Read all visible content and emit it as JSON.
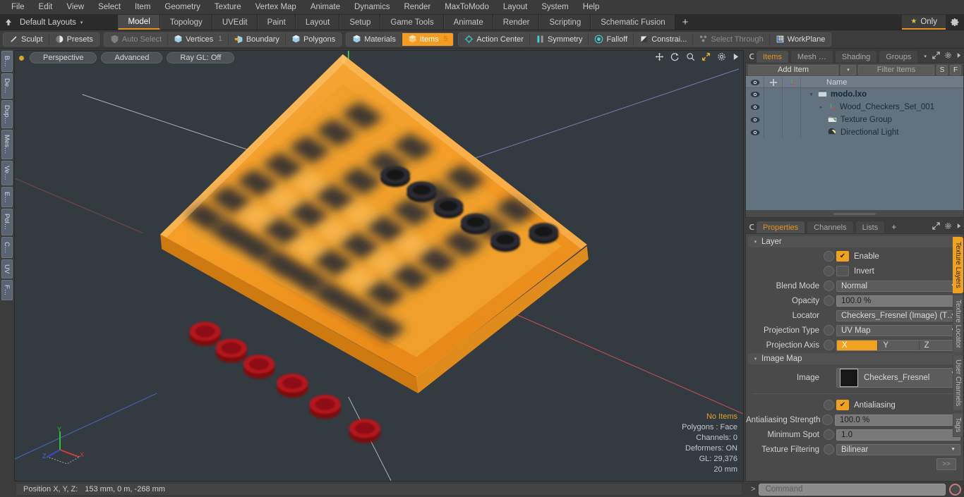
{
  "app": {
    "title": "modo",
    "accent": "#f0a11e",
    "panel_bg": "#4a4a4a",
    "viewport_bg": "#333b40"
  },
  "menubar": {
    "items": [
      {
        "label": "File"
      },
      {
        "label": "Edit"
      },
      {
        "label": "View"
      },
      {
        "label": "Select"
      },
      {
        "label": "Item"
      },
      {
        "label": "Geometry"
      },
      {
        "label": "Texture"
      },
      {
        "label": "Vertex Map"
      },
      {
        "label": "Animate"
      },
      {
        "label": "Dynamics"
      },
      {
        "label": "Render"
      },
      {
        "label": "MaxToModo"
      },
      {
        "label": "Layout"
      },
      {
        "label": "System"
      },
      {
        "label": "Help"
      }
    ]
  },
  "layoutbar": {
    "home_icon": "home-icon",
    "layout_name": "Default Layouts",
    "caret": "▾",
    "tabs": [
      {
        "label": "Model",
        "active": true
      },
      {
        "label": "Topology",
        "active": false
      },
      {
        "label": "UVEdit",
        "active": false
      },
      {
        "label": "Paint",
        "active": false
      },
      {
        "label": "Layout",
        "active": false
      },
      {
        "label": "Setup",
        "active": false
      },
      {
        "label": "Game Tools",
        "active": false
      },
      {
        "label": "Animate",
        "active": false
      },
      {
        "label": "Render",
        "active": false
      },
      {
        "label": "Scripting",
        "active": false
      },
      {
        "label": "Schematic Fusion",
        "active": false
      }
    ],
    "add_tab": "+",
    "only_label": "Only",
    "only_star": "★",
    "gear_icon": "gear-icon"
  },
  "toolbar": {
    "group_left": [
      {
        "label": "Sculpt",
        "icon": "sculpt-pen-icon",
        "state": "normal"
      },
      {
        "label": "Presets",
        "icon": "presets-sphere-icon",
        "state": "normal"
      }
    ],
    "group_select": [
      {
        "label": "Auto Select",
        "icon": "auto-select-icon",
        "state": "dim",
        "count": ""
      },
      {
        "label": "Vertices",
        "icon": "vertices-icon",
        "state": "normal",
        "count": "1"
      },
      {
        "label": "Boundary",
        "icon": "boundary-icon",
        "state": "normal",
        "count": ""
      },
      {
        "label": "Polygons",
        "icon": "polygons-icon",
        "state": "normal",
        "count": ""
      }
    ],
    "group_items": [
      {
        "label": "Materials",
        "icon": "materials-icon",
        "state": "normal",
        "count": ""
      },
      {
        "label": "Items",
        "icon": "items-icon",
        "state": "active",
        "count": "5"
      }
    ],
    "group_tools": [
      {
        "label": "Action Center",
        "icon": "action-center-icon",
        "state": "normal"
      },
      {
        "label": "Symmetry",
        "icon": "symmetry-icon",
        "state": "normal"
      },
      {
        "label": "Falloff",
        "icon": "falloff-icon",
        "state": "normal"
      },
      {
        "label": "Constrai...",
        "icon": "constraint-icon",
        "state": "normal"
      },
      {
        "label": "Select Through",
        "icon": "select-through-icon",
        "state": "dim"
      },
      {
        "label": "WorkPlane",
        "icon": "workplane-icon",
        "state": "normal"
      }
    ]
  },
  "left_tabs": [
    {
      "label": "B…"
    },
    {
      "label": "De…"
    },
    {
      "label": "Dup…"
    },
    {
      "label": "Mes…"
    },
    {
      "label": "Ve…"
    },
    {
      "label": "E…"
    },
    {
      "label": "Pol…"
    },
    {
      "label": "C…"
    },
    {
      "label": "UV"
    },
    {
      "label": "F…"
    }
  ],
  "viewport": {
    "mode": "Perspective",
    "shading": "Advanced",
    "raygl": "Ray GL: Off",
    "icons": [
      {
        "name": "move-icon",
        "glyph": "✥"
      },
      {
        "name": "rotate-icon",
        "glyph": "↻"
      },
      {
        "name": "zoom-icon",
        "glyph": "⌕"
      },
      {
        "name": "fit-icon",
        "glyph": "⤡"
      },
      {
        "name": "gear-icon",
        "glyph": "⚙"
      },
      {
        "name": "play-icon",
        "glyph": "▸"
      }
    ],
    "stats": [
      {
        "text": "No Items",
        "highlight": true
      },
      {
        "text": "Polygons : Face",
        "highlight": false
      },
      {
        "text": "Channels: 0",
        "highlight": false
      },
      {
        "text": "Deformers: ON",
        "highlight": false
      },
      {
        "text": "GL: 29,376",
        "highlight": false
      },
      {
        "text": "20 mm",
        "highlight": false
      }
    ],
    "gizmo": {
      "x": "X",
      "y": "Y",
      "z": "Z"
    },
    "scene_description": "Orange wooden checkers board with red checkers along the near-left edge and black checkers along the far-right edge"
  },
  "statusbar": {
    "position_label": "Position X, Y, Z:",
    "position_value": "153 mm, 0 m, -268 mm"
  },
  "items_panel": {
    "tabs": [
      {
        "label": "Items",
        "active": true
      },
      {
        "label": "Mesh …",
        "active": false
      },
      {
        "label": "Shading",
        "active": false
      },
      {
        "label": "Groups",
        "active": false
      }
    ],
    "tab_caret": "▾",
    "expand_icon": "expand-icon",
    "gear_icon": "gear-icon",
    "more_icon": "chevron-right-icon",
    "add_item_label": "Add Item",
    "add_item_caret": "▾",
    "filter_placeholder": "Filter Items",
    "s_button": "S",
    "f_button": "F",
    "columns": {
      "eye": "eye-icon",
      "lock": "move-icon",
      "axis": "axis-icon",
      "name": "Name"
    },
    "rows": [
      {
        "name": "modo.lxo",
        "icon": "scene-clapper-icon",
        "indent": 0,
        "tri": "▾",
        "root": true
      },
      {
        "name": "Wood_Checkers_Set_001",
        "icon": "mesh-axis-icon",
        "indent": 1,
        "tri": "▸",
        "root": false
      },
      {
        "name": "Texture Group",
        "icon": "texture-group-icon",
        "indent": 1,
        "tri": "",
        "root": false
      },
      {
        "name": "Directional Light",
        "icon": "light-icon",
        "indent": 1,
        "tri": "",
        "root": false
      }
    ]
  },
  "properties_panel": {
    "tabs": [
      {
        "label": "Properties",
        "active": true
      },
      {
        "label": "Channels",
        "active": false
      },
      {
        "label": "Lists",
        "active": false
      }
    ],
    "add_tab": "+",
    "expand_icon": "expand-icon",
    "gear_icon": "gear-icon",
    "more_icon": "chevron-right-icon",
    "layer_section": {
      "title": "Layer",
      "tri": "▾",
      "rows": [
        {
          "type": "checkbox",
          "label": "Enable",
          "checked": true,
          "check": "✔"
        },
        {
          "type": "checkbox",
          "label": "Invert",
          "checked": false,
          "check": ""
        },
        {
          "type": "dropdown",
          "label": "Blend Mode",
          "value": "Normal",
          "dot": true
        },
        {
          "type": "slider",
          "label": "Opacity",
          "value": "100.0 %",
          "dot": true
        },
        {
          "type": "dropdown",
          "label": "Locator",
          "value": "Checkers_Fresnel (Image) (T …",
          "dot": false
        },
        {
          "type": "dropdown",
          "label": "Projection Type",
          "value": "UV Map",
          "dot": true
        },
        {
          "type": "segmented",
          "label": "Projection Axis",
          "options": [
            "X",
            "Y",
            "Z"
          ],
          "selected": 0,
          "dot": true
        }
      ]
    },
    "image_map_section": {
      "title": "Image Map",
      "tri": "▾",
      "image_label": "Image",
      "image_value": "Checkers_Fresnel",
      "image_swatch": "#171717",
      "rows": [
        {
          "type": "checkbox",
          "label": "Antialiasing",
          "checked": true,
          "check": "✔"
        },
        {
          "type": "slider",
          "label": "Antialiasing Strength",
          "value": "100.0 %",
          "dot": true
        },
        {
          "type": "slider",
          "label": "Minimum Spot",
          "value": "1.0",
          "dot": true
        },
        {
          "type": "dropdown",
          "label": "Texture Filtering",
          "value": "Bilinear",
          "dot": true
        }
      ],
      "more_button": ">>"
    },
    "side_tabs": [
      {
        "label": "Texture Layers",
        "active": true
      },
      {
        "label": "Texture Locator",
        "active": false
      },
      {
        "label": "User Channels",
        "active": false
      },
      {
        "label": "Tags",
        "active": false
      }
    ]
  },
  "command_bar": {
    "arrow": ">",
    "placeholder": "Command",
    "record_icon": "record-icon"
  }
}
